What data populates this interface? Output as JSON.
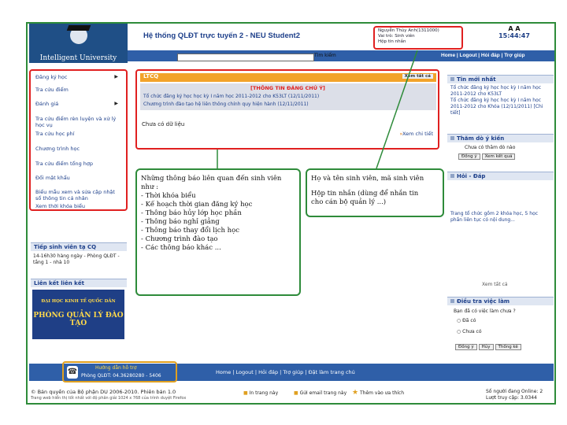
{
  "header": {
    "logo_name": "Intelligent University",
    "system_title": "Hệ thống QLĐT trực tuyến 2 - NEU Student2",
    "user_line1": "Nguyễn Thùy Anh(1311000)",
    "user_line2": "Vai trò: Sinh viên",
    "user_line3": "Hộp tin nhắn",
    "font_sizes": "A  A",
    "clock": "15:44:47",
    "search_button": "Tìm kiếm",
    "nav": "Home | Logout | Hỏi đáp | Trợ giúp"
  },
  "left_menu": {
    "items": [
      {
        "label": "Đăng ký học",
        "arrow": "▶"
      },
      {
        "label": "Tra cứu điểm",
        "arrow": ""
      },
      {
        "label": "Đánh giá",
        "arrow": "▶"
      },
      {
        "label": "Tra cứu điểm rèn luyện và xử lý học vụ",
        "arrow": ""
      },
      {
        "label": "Tra cứu học phí",
        "arrow": ""
      },
      {
        "label": "Chương trình học",
        "arrow": ""
      },
      {
        "label": "Tra cứu điểm tổng hợp",
        "arrow": ""
      },
      {
        "label": "Đổi mật khẩu",
        "arrow": ""
      },
      {
        "label": "Biểu mẫu xem và sửa cập nhật sổ thông tin cá nhân",
        "arrow": ""
      },
      {
        "label": "Xem thời khóa biểu",
        "arrow": ""
      }
    ],
    "tiep_sv_title": "Tiếp sinh viên tạ CQ",
    "tiep_sv_text": "14-16h30 hàng ngày - Phòng QLĐT - tầng 1 - nhà 10",
    "links_title": "Liên kết liên kết",
    "banner_small": "ĐẠI HỌC KINH TẾ QUỐC DÂN",
    "banner_big": "PHÒNG QUẢN LÝ ĐÀO TẠO"
  },
  "ltcq": {
    "title": "LTCQ",
    "more": "Xem tất cả",
    "notice_title": "[THÔNG TIN ĐÁNG CHÚ Ý]",
    "notice_1": "Tổ chức đăng ký học học kỳ I năm học 2011-2012 cho K53LT (12/11/2011)",
    "notice_2": "Chương trình đào tạo hệ liên thông chính quy hiện hành (12/11/2011)",
    "empty": "Chưa có dữ liệu",
    "detail": "Xem chi tiết"
  },
  "notes": {
    "left_lines": [
      "Những thông báo liên quan đến sinh viên",
      "như :",
      "- Thời khóa biểu",
      "- Kế hoạch thời gian đăng ký học",
      "- Thông báo hủy lớp học phần",
      "- Thông báo nghỉ giảng",
      "- Thông báo thay đổi lịch học",
      "- Chương trình đào tạo",
      "- Các thông báo khác ..."
    ],
    "right_lines": [
      "Họ và tên sinh viên, mã sinh viên",
      "Hộp tin nhắn (dùng để nhắn tin",
      "cho cán bộ quản lý ...)"
    ]
  },
  "right": {
    "news_title": "Tin mới nhất",
    "news_text": "Tổ chức đăng ký học học kỳ I năm học 2011-2012 cho K53LT",
    "news_text2": "Tổ chức đăng ký học học kỳ I năm học 2011-2012 cho Khóa (12/11/2011) [Chi tiết]",
    "poll_title": "Thăm dò ý kiến",
    "poll_text": "Chưa có thăm dò nào",
    "poll_agree": "Đồng ý",
    "poll_result": "Xem kết quả",
    "qa_title": "Hỏi - Đáp",
    "qa_text": "Trang tổ chức gồm 2 khóa học, 5 học phần liên tục có nội dung...",
    "qa_more": "Xem tất cả",
    "survey_title": "Điều tra việc làm",
    "survey_question": "Bạn đã có việc làm chưa ?",
    "survey_opt1": "Đã có",
    "survey_opt2": "Chưa có",
    "survey_btn1": "Đồng ý",
    "survey_btn2": "Hủy",
    "survey_btn3": "Thống kê"
  },
  "footer": {
    "contact_title": "Hướng dẫn hỗ trợ",
    "contact_phone": "Phòng QLĐT: 04.36280280 - 5406",
    "nav": "Home | Logout | Hỏi đáp | Trợ giúp | Đặt làm trang chủ",
    "copyright": "© Bản quyền của Bộ phận DU 2006-2010. Phiên bản 1.0",
    "copyright2": "Trang web hiển thị tốt nhất với độ phân giải 1024 x 768 của trình duyệt Firefox",
    "tool1": "In trang này",
    "tool2": "Gửi email trang này",
    "tool3": "Thêm vào ưa thích",
    "online": "Số người đang Online: 2",
    "visits": "Lượt truy cập: 3.0344"
  }
}
